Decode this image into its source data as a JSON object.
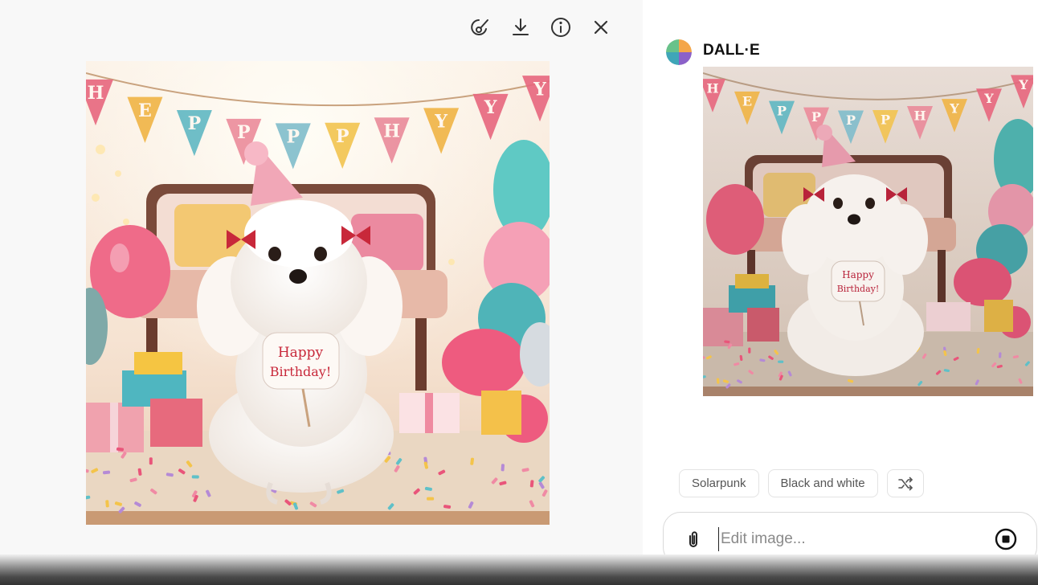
{
  "viewer": {
    "toolbar": {
      "edit_icon": "brush-select-icon",
      "download_icon": "download-icon",
      "info_icon": "info-icon",
      "close_icon": "close-icon"
    },
    "image": {
      "bunting_letters": [
        "H",
        "E",
        "P",
        "P",
        "P",
        "P",
        "H",
        "Y",
        "Y",
        "Y"
      ],
      "sign_line1": "Happy",
      "sign_line2": "Birthday!"
    }
  },
  "panel": {
    "author": "DALL·E",
    "thumbnail": {
      "bunting_letters": [
        "H",
        "E",
        "P",
        "P",
        "P",
        "P",
        "H",
        "Y",
        "Y",
        "Y"
      ],
      "sign_line1": "Happy",
      "sign_line2": "Birthday!"
    },
    "suggestions": [
      "Solarpunk",
      "Black and white"
    ],
    "shuffle_icon": "shuffle-icon",
    "composer": {
      "placeholder": "Edit image...",
      "attach_icon": "paperclip-icon",
      "stop_icon": "stop-icon"
    }
  },
  "colors": {
    "viewer_bg": "#f8f8f8",
    "panel_bg": "#ffffff",
    "chip_border": "#e3e3e3"
  }
}
